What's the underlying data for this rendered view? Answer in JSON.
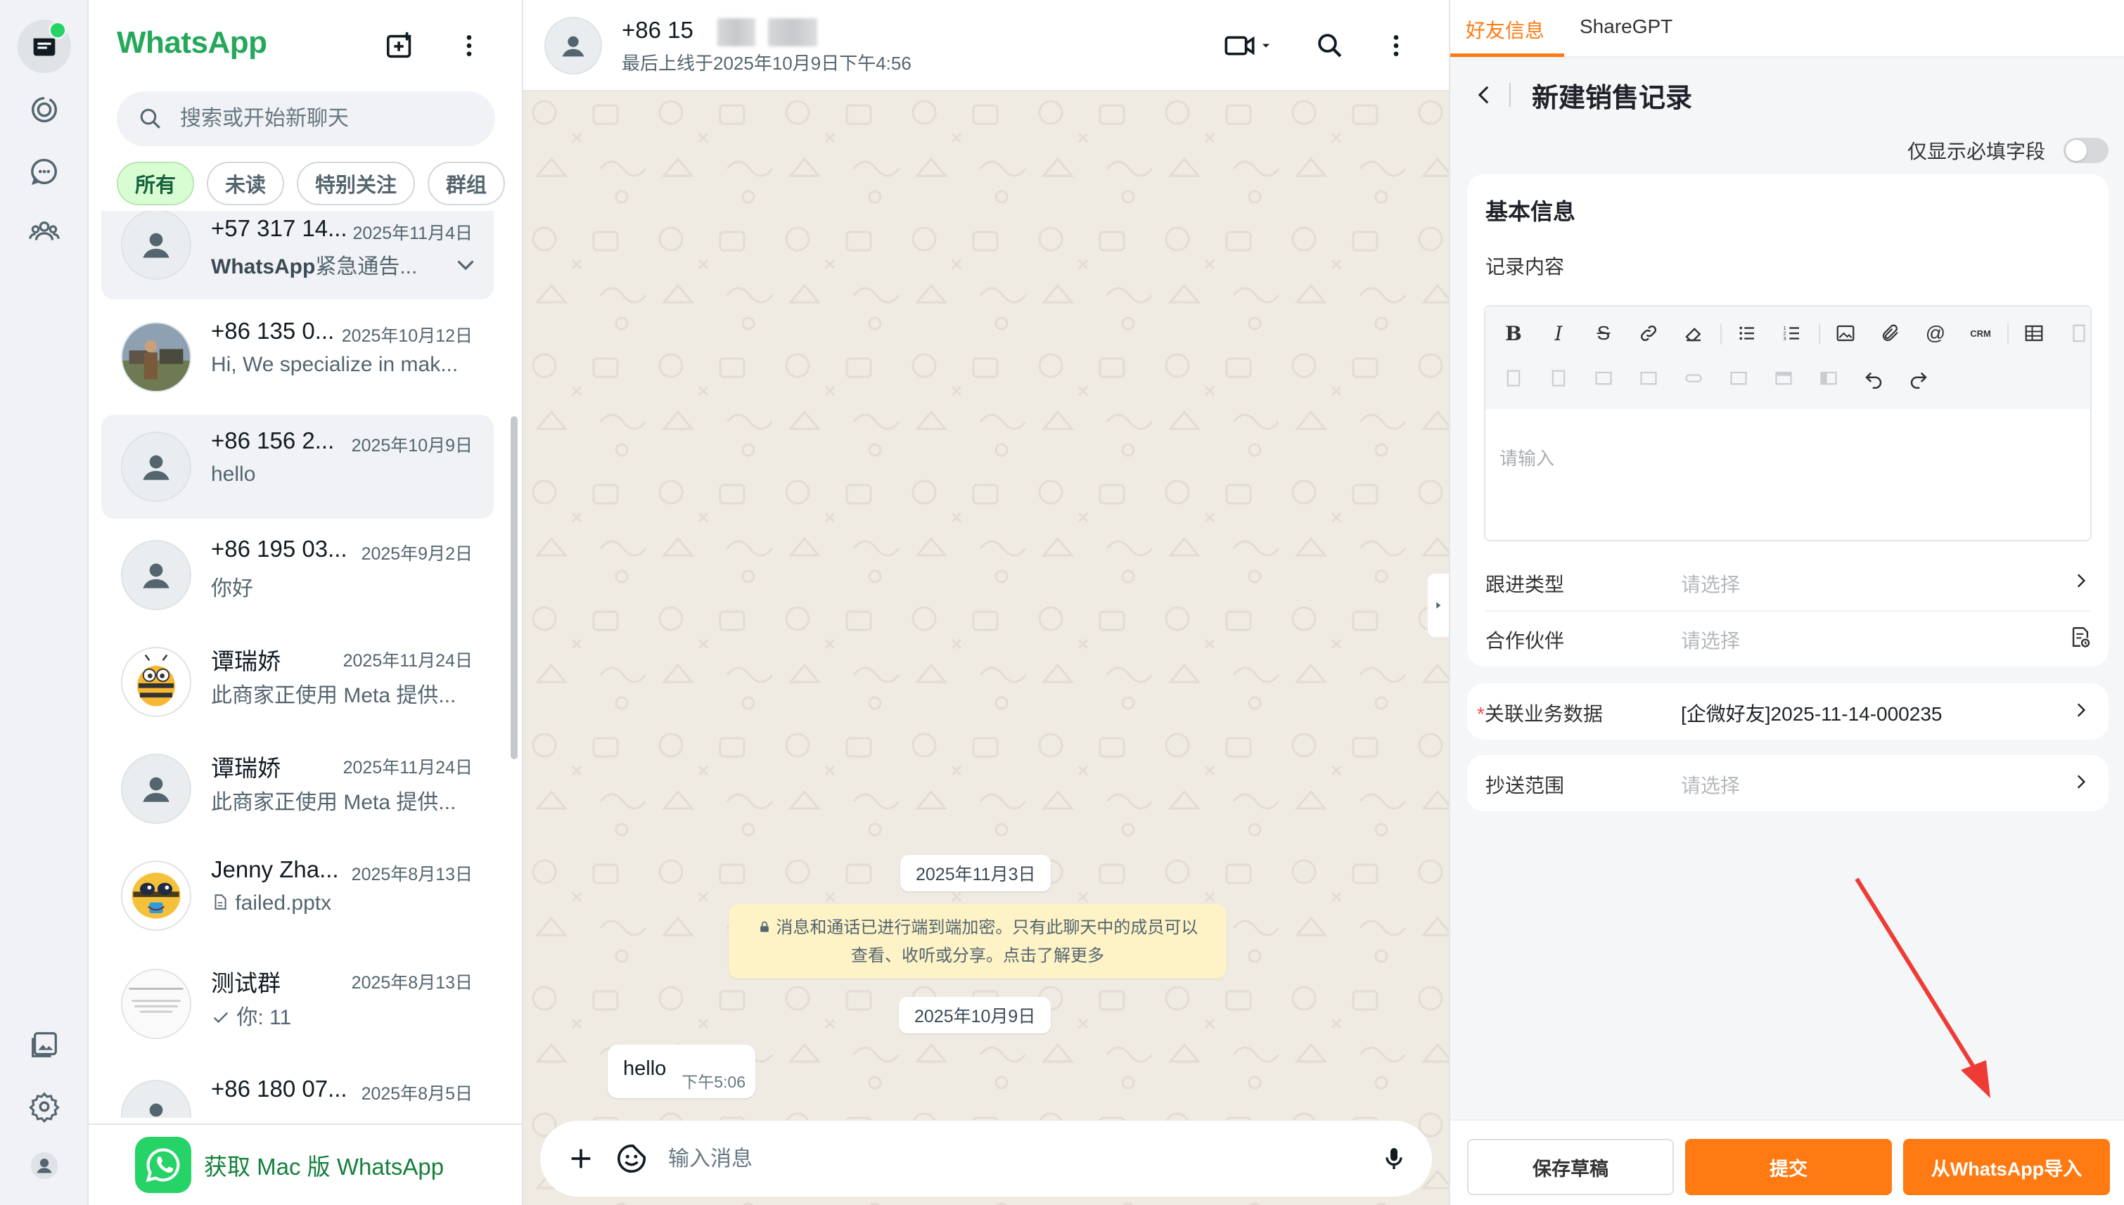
{
  "rail": {
    "icons": [
      "chats-icon",
      "status-icon",
      "channels-icon",
      "communities-icon",
      "media-icon",
      "settings-icon",
      "profile-icon"
    ]
  },
  "list": {
    "title": "WhatsApp",
    "search_placeholder": "搜索或开始新聊天",
    "filters": [
      "所有",
      "未读",
      "特别关注",
      "群组"
    ],
    "chats": [
      {
        "name": "+57 317 14...",
        "date": "2025年11月4日",
        "preview_bold": "WhatsApp",
        "preview": "紧急通告...",
        "avatar": "default",
        "selected": true
      },
      {
        "name": "+86 135 0...",
        "date": "2025年10月12日",
        "preview_bold": "",
        "preview": "Hi, We specialize in mak...",
        "avatar": "photo",
        "selected": false
      },
      {
        "name": "+86 156 2...",
        "date": "2025年10月9日",
        "preview_bold": "",
        "preview": "hello",
        "avatar": "default",
        "selected": true
      },
      {
        "name": "+86 195 03...",
        "date": "2025年9月2日",
        "preview_bold": "",
        "preview": "你好",
        "avatar": "default",
        "selected": false
      },
      {
        "name": "谭瑞娇",
        "date": "2025年11月24日",
        "preview_bold": "",
        "preview": "此商家正使用 Meta 提供...",
        "avatar": "bee",
        "selected": false
      },
      {
        "name": "谭瑞娇",
        "date": "2025年11月24日",
        "preview_bold": "",
        "preview": "此商家正使用 Meta 提供...",
        "avatar": "default",
        "selected": false
      },
      {
        "name": "Jenny Zha...",
        "date": "2025年8月13日",
        "preview_bold": "",
        "preview": "failed.pptx",
        "avatar": "bee2",
        "selected": false
      },
      {
        "name": "测试群",
        "date": "2025年8月13日",
        "preview_bold": "",
        "preview": "你: 11",
        "avatar": "doc",
        "selected": false
      },
      {
        "name": "+86 180 07...",
        "date": "2025年8月5日",
        "preview_bold": "",
        "preview": "",
        "avatar": "default",
        "selected": false
      }
    ],
    "footer_text": "获取 Mac 版 WhatsApp"
  },
  "conversation": {
    "contact_name": "+86 15",
    "status": "最后上线于2025年10月9日下午4:56",
    "dates": [
      "2025年11月3日",
      "2025年10月9日"
    ],
    "system_message_line1": "消息和通话已进行端到端加密。只有此聊天中的成员可以",
    "system_message_line2": "查看、收听或分享。点击了解更多",
    "messages": [
      {
        "text": "hello",
        "time": "下午5:06"
      }
    ],
    "input_placeholder": "输入消息"
  },
  "crm": {
    "tabs": [
      "好友信息",
      "ShareGPT"
    ],
    "title": "新建销售记录",
    "required_only_label": "仅显示必填字段",
    "section_title": "基本信息",
    "content_label": "记录内容",
    "editor_placeholder": "请输入",
    "fields": [
      {
        "label": "跟进类型",
        "value": "请选择"
      },
      {
        "label": "合作伙伴",
        "value": "请选择"
      }
    ],
    "related": {
      "label": "关联业务数据",
      "value": "[企微好友]2025-11-14-000235"
    },
    "cc": {
      "label": "抄送范围",
      "value": "请选择"
    },
    "buttons": {
      "draft": "保存草稿",
      "submit": "提交",
      "import": "从WhatsApp导入"
    },
    "accent_color": "#ff7a12"
  }
}
